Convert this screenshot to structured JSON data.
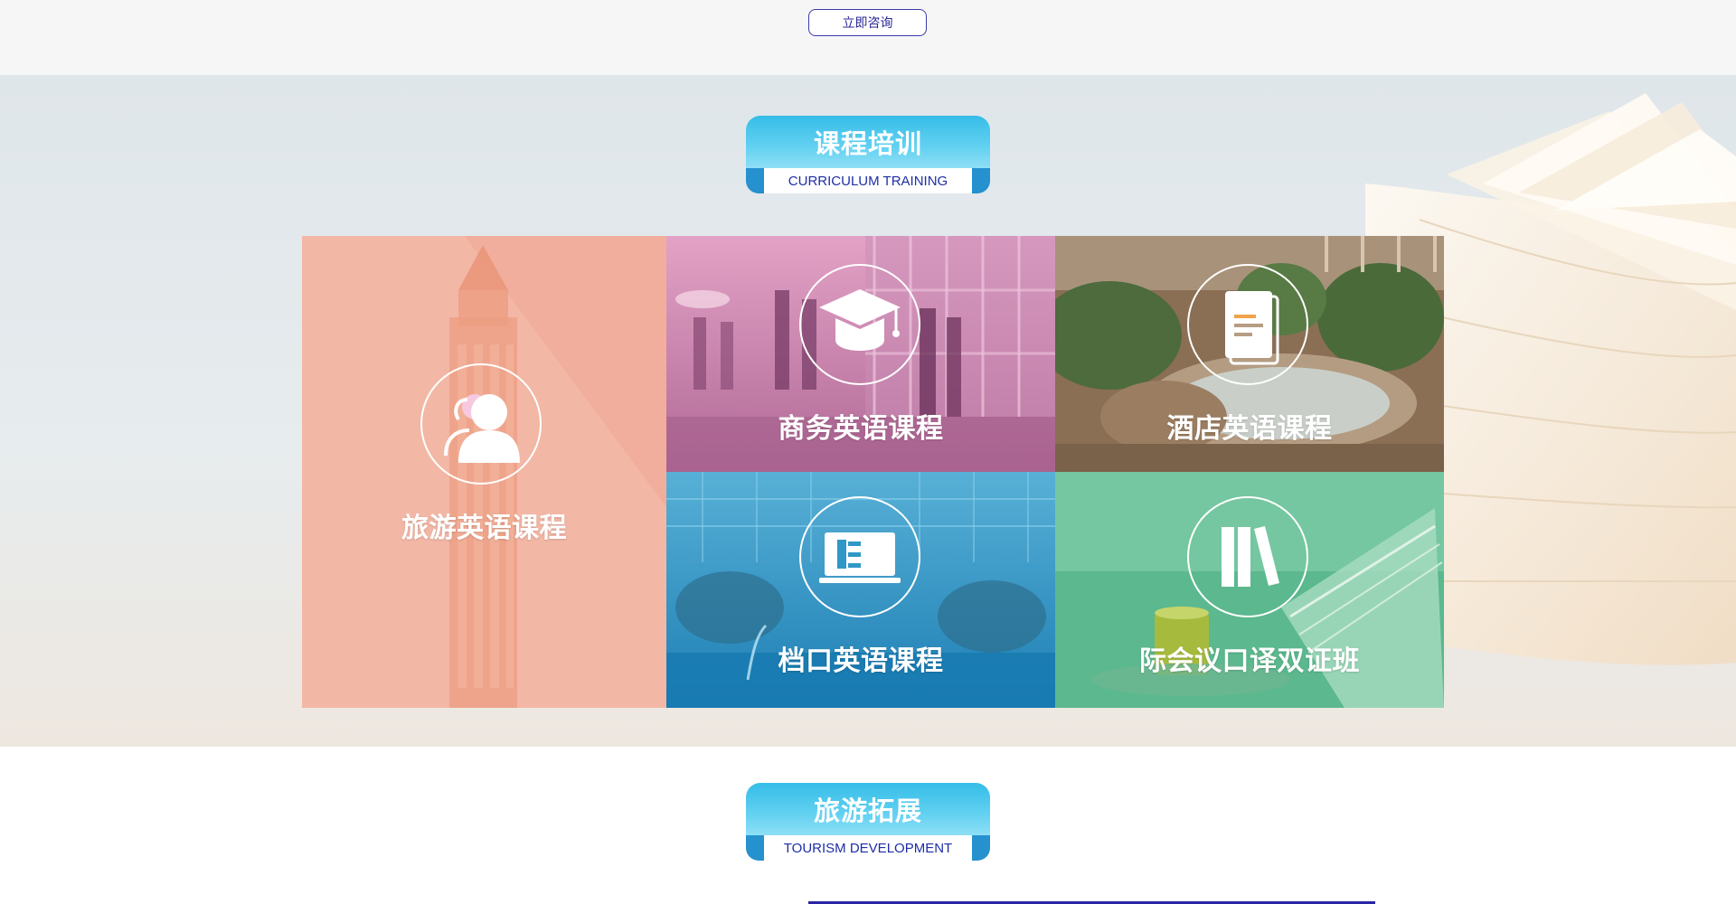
{
  "header": {
    "consult_button": "立即咨询"
  },
  "course_section": {
    "title": "课程培训",
    "subtitle": "CURRICULUM TRAINING",
    "tiles": [
      {
        "label": "旅游英语课程",
        "icon": "people-icon",
        "color": "#f3b7a6"
      },
      {
        "label": "商务英语课程",
        "icon": "graduation-cap-icon",
        "color": "#c77fa6"
      },
      {
        "label": "酒店英语课程",
        "icon": "book-icon",
        "color": "#8a6a4a"
      },
      {
        "label": "档口英语课程",
        "icon": "presentation-board-icon",
        "color": "#2f98c6"
      },
      {
        "label": "际会议口译双证班",
        "icon": "books-icon",
        "color": "#5cb88e"
      }
    ]
  },
  "tourism_section": {
    "title": "旅游拓展",
    "subtitle": "TOURISM DEVELOPMENT"
  },
  "colors": {
    "accent_blue": "#2b25a6",
    "ribbon_cyan": "#35bde8",
    "ribbon_dark": "#2591cf"
  }
}
